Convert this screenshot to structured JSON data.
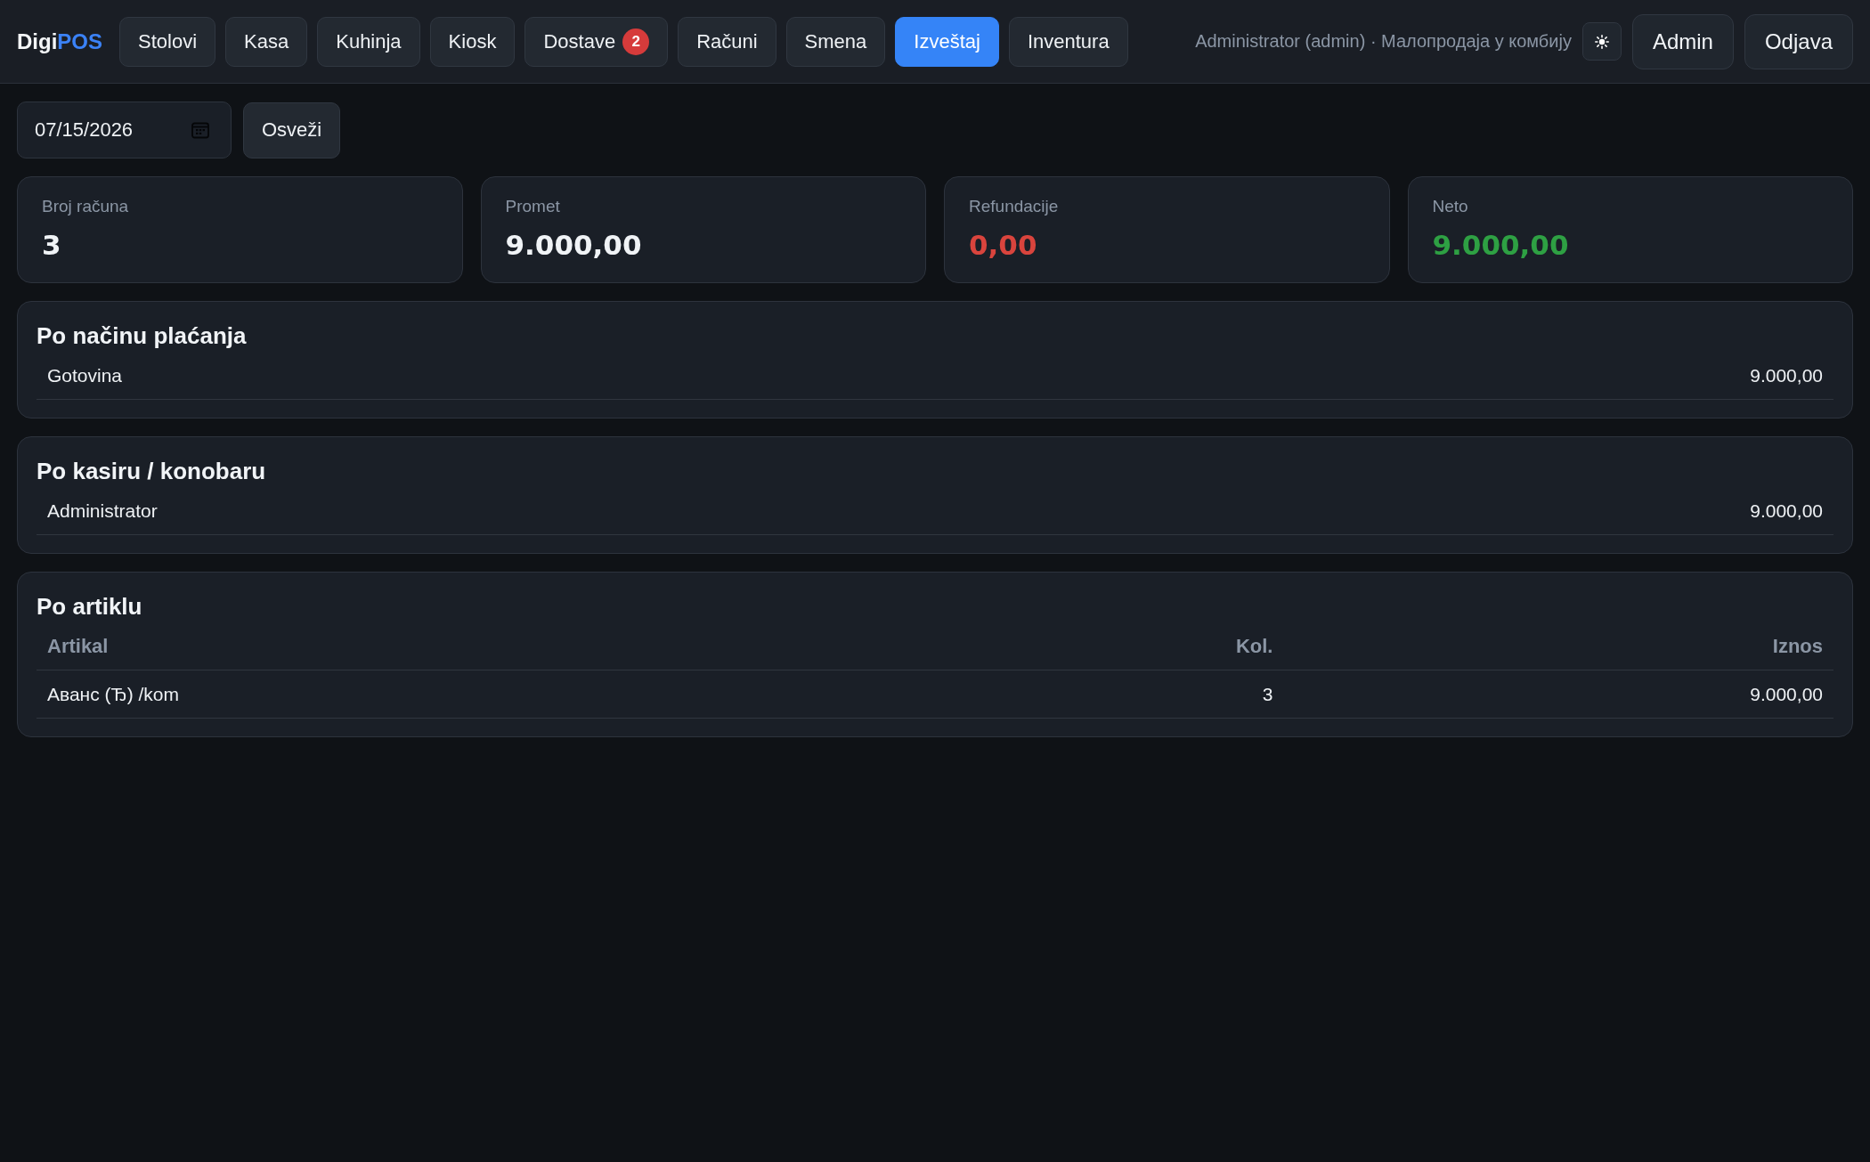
{
  "header": {
    "logo": {
      "text": "Digi",
      "accent": "POS"
    },
    "nav_tabs": [
      {
        "label": "Stolovi",
        "selected": false
      },
      {
        "label": "Kasa",
        "selected": false
      },
      {
        "label": "Kuhinja",
        "selected": false
      },
      {
        "label": "Kiosk",
        "selected": false
      },
      {
        "label": "Dostave",
        "selected": false,
        "badge": "2"
      },
      {
        "label": "Računi",
        "selected": false
      },
      {
        "label": "Smena",
        "selected": false
      },
      {
        "label": "Izveštaj",
        "selected": true
      },
      {
        "label": "Inventura",
        "selected": false
      }
    ],
    "user_info": "Administrator (admin) · Малопродаја у комбију",
    "buttons": [
      "Admin",
      "Odjava"
    ]
  },
  "toolbar": {
    "date_field": {
      "value": "07/15/2026"
    },
    "refresh_button": "Osveži"
  },
  "summary_cards": [
    {
      "label": "Broj računa",
      "value": "3",
      "color": "#f0f3f6"
    },
    {
      "label": "Promet",
      "value": "9.000,00",
      "color": "#f0f3f6"
    },
    {
      "label": "Refundacije",
      "value": "0,00",
      "color": "#d9443d"
    },
    {
      "label": "Neto",
      "value": "9.000,00",
      "color": "#2ea043"
    }
  ],
  "sections": [
    {
      "kind": "list",
      "title": "Po načinu plaćanja",
      "rows": [
        [
          "Gotovina",
          "9.000,00"
        ]
      ]
    },
    {
      "kind": "list",
      "title": "Po kasiru / konobaru",
      "rows": [
        [
          "Administrator",
          "9.000,00"
        ]
      ]
    },
    {
      "kind": "table",
      "title": "Po artiklu",
      "columns": [
        "Artikal",
        "Kol.",
        "Iznos"
      ],
      "rows": [
        [
          "Аванс (Ђ) /kom",
          "3",
          "9.000,00"
        ]
      ]
    }
  ]
}
